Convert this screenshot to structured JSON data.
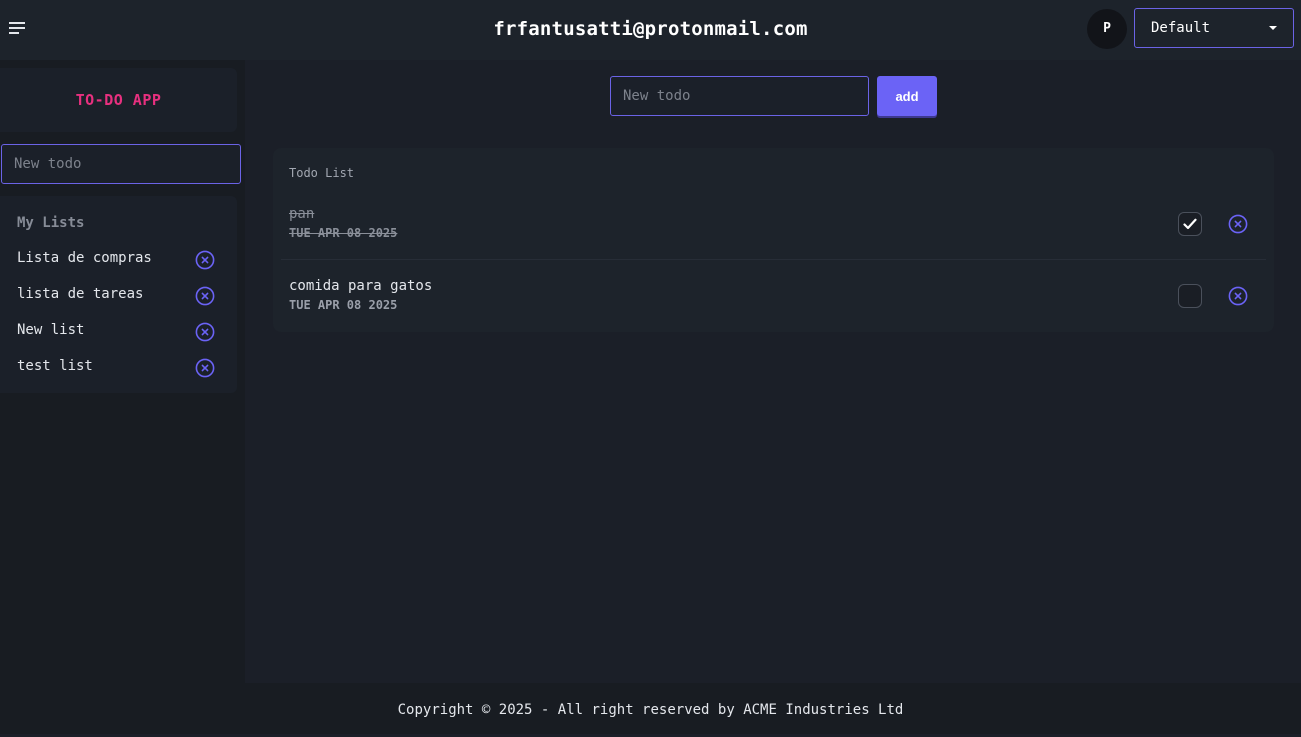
{
  "header": {
    "title": "frfantusatti@protonmail.com",
    "avatar_initial": "P",
    "theme_selected": "Default"
  },
  "sidebar": {
    "brand": "TO-DO APP",
    "new_todo_placeholder": "New todo",
    "lists_heading": "My Lists",
    "lists": [
      {
        "label": "Lista de compras"
      },
      {
        "label": "lista de tareas"
      },
      {
        "label": "New list"
      },
      {
        "label": "test list"
      }
    ]
  },
  "main": {
    "new_todo_placeholder": "New todo",
    "add_label": "add",
    "card_title": "Todo List",
    "todos": [
      {
        "name": "pan",
        "date": "TUE APR 08 2025",
        "done": true
      },
      {
        "name": "comida para gatos",
        "date": "TUE APR 08 2025",
        "done": false
      }
    ]
  },
  "footer": {
    "text": "Copyright © 2025 - All right reserved by ACME Industries Ltd"
  },
  "colors": {
    "accent": "#6b63f6",
    "brand": "#e8307f",
    "background": "#1b1f28"
  },
  "icons": {
    "menu": "menu-lines-icon",
    "delete": "x-circle-icon",
    "check": "checkmark-icon",
    "caret": "caret-down-icon"
  }
}
